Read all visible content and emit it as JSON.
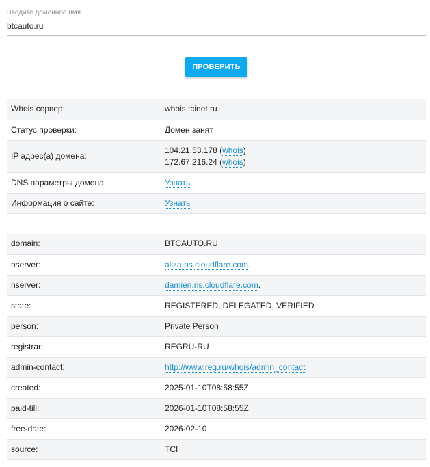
{
  "domain_input": {
    "label": "Введите доменное имя",
    "value": "btcauto.ru"
  },
  "check_button": {
    "label": "ПРОВЕРИТЬ"
  },
  "summary": {
    "whois_server": {
      "label": "Whois сервер:",
      "value": "whois.tcinet.ru"
    },
    "check_status": {
      "label": "Статус проверки:",
      "value": "Домен занят"
    },
    "ip": {
      "label": "IP адрес(а) домена:",
      "rows": [
        {
          "addr": "104.21.53.178",
          "open": " (",
          "link": "whois",
          "close": ")"
        },
        {
          "addr": "172.67.216.24",
          "open": " (",
          "link": "whois",
          "close": ")"
        }
      ]
    },
    "dns": {
      "label": "DNS параметры домена:",
      "link": "Узнать"
    },
    "site_info": {
      "label": "Информация о сайте:",
      "link": "Узнать"
    }
  },
  "whois": [
    {
      "key": "domain:",
      "value": "BTCAUTO.RU"
    },
    {
      "key": "nserver:",
      "link": "aliza.ns.cloudflare.com",
      "suffix": "."
    },
    {
      "key": "nserver:",
      "link": "damien.ns.cloudflare.com",
      "suffix": "."
    },
    {
      "key": "state:",
      "value": "REGISTERED, DELEGATED, VERIFIED"
    },
    {
      "key": "person:",
      "value": "Private Person"
    },
    {
      "key": "registrar:",
      "value": "REGRU-RU"
    },
    {
      "key": "admin-contact:",
      "link": "http://www.reg.ru/whois/admin_contact"
    },
    {
      "key": "created:",
      "value": "2025-01-10T08:58:55Z"
    },
    {
      "key": "paid-till:",
      "value": "2026-01-10T08:58:55Z"
    },
    {
      "key": "free-date:",
      "value": "2026-02-10"
    },
    {
      "key": "source:",
      "value": "TCI"
    }
  ],
  "colors": {
    "accent": "#0eaaf0",
    "link": "#1a8fd3",
    "row_alt": "#f4f5f6",
    "border": "#e2e4e7"
  }
}
